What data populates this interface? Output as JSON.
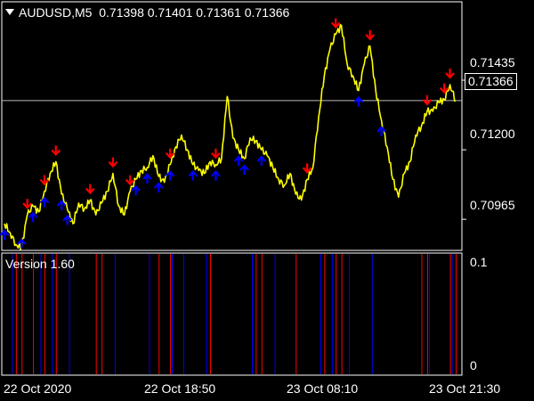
{
  "header": {
    "symbol_timeframe": "AUDUSD,M5",
    "quote_values": "0.71398 0.71401 0.71361 0.71366"
  },
  "price_axis": {
    "ticks": [
      "0.71435",
      "0.71200",
      "0.70965"
    ],
    "current_price": "0.71366"
  },
  "indicator": {
    "version_label": "Version 1.60",
    "axis_ticks": [
      "0.1",
      "0"
    ]
  },
  "time_axis": {
    "labels": [
      "22 Oct 2020",
      "22 Oct 18:50",
      "23 Oct 08:10",
      "23 Oct 21:30"
    ]
  },
  "colors": {
    "background": "#000000",
    "price_line": "#FFFF00",
    "sell_arrow": "#FF0000",
    "buy_arrow": "#0000FF",
    "grid": "#FFFFFF"
  },
  "chart_data": {
    "type": "line",
    "series": [
      {
        "values": [
          0.7095,
          0.7092,
          0.7088,
          0.7087,
          0.7098,
          0.7101,
          0.7099,
          0.7106,
          0.7112,
          0.7116,
          0.7105,
          0.71,
          0.7095,
          0.7102,
          0.71,
          0.7103,
          0.7098,
          0.7102,
          0.7106,
          0.7112,
          0.7101,
          0.7098,
          0.7106,
          0.711,
          0.7113,
          0.7114,
          0.7118,
          0.7111,
          0.7109,
          0.7115,
          0.7121,
          0.7125,
          0.712,
          0.7115,
          0.7113,
          0.7112,
          0.7116,
          0.7115,
          0.7117,
          0.7138,
          0.7124,
          0.712,
          0.7117,
          0.7124,
          0.7123,
          0.712,
          0.7118,
          0.7114,
          0.711,
          0.7108,
          0.7112,
          0.7105,
          0.7103,
          0.711,
          0.7114,
          0.7131,
          0.7145,
          0.7154,
          0.7159,
          0.7162,
          0.7149,
          0.7145,
          0.714,
          0.7149,
          0.7155,
          0.714,
          0.713,
          0.7121,
          0.711,
          0.7104,
          0.7112,
          0.7116,
          0.7125,
          0.7128,
          0.7133,
          0.7133,
          0.7136,
          0.7137,
          0.7142,
          0.71366
        ]
      }
    ],
    "sell_arrow_bars": [
      4,
      7,
      9,
      15,
      19,
      22,
      29,
      37,
      53,
      58,
      64,
      74,
      77,
      78
    ],
    "buy_arrow_bars": [
      0,
      3,
      5,
      7,
      10,
      11,
      23,
      25,
      27,
      29,
      33,
      37,
      41,
      42,
      45,
      62,
      66
    ],
    "indicator_red_bars": [
      2,
      3,
      5,
      7,
      9,
      16,
      17,
      27,
      29,
      36,
      44,
      45,
      51,
      56,
      58,
      59,
      73,
      74,
      78,
      79
    ],
    "indicator_blue_bars": [
      1,
      6,
      8,
      11,
      19,
      25,
      29,
      31,
      35,
      43,
      47,
      55,
      57,
      60,
      64,
      74,
      78
    ],
    "y_range": [
      0.7086,
      0.717
    ],
    "indicator_range": [
      0,
      0.1
    ],
    "grid": false
  }
}
